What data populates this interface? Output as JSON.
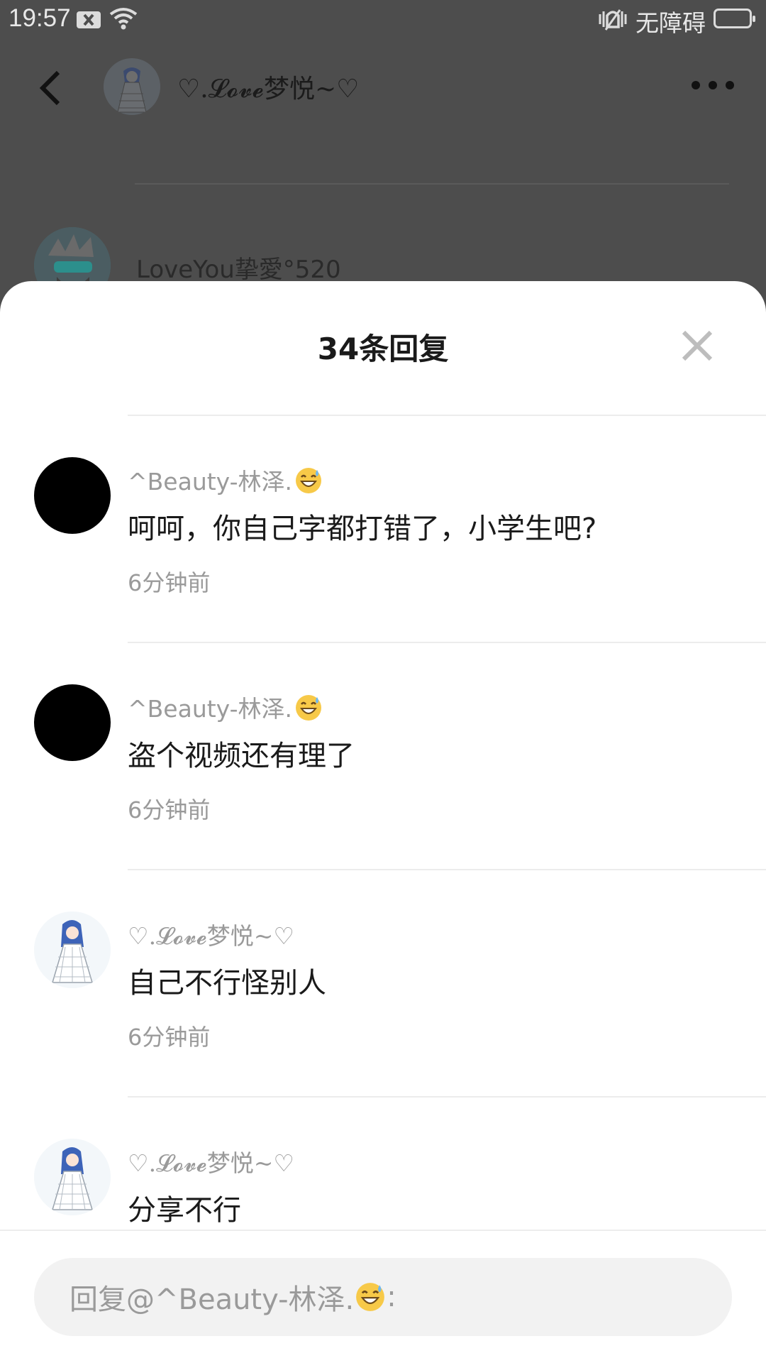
{
  "status_bar": {
    "time": "19:57",
    "accessibility_label": "无障碍"
  },
  "header": {
    "title": "♡.𝓛𝓸𝓿𝓮梦悦~♡",
    "background_comment_name": "LoveYou挚愛°520"
  },
  "sheet": {
    "title": "34条回复",
    "comments": [
      {
        "name": "^Beauty-林泽.",
        "name_emoji": "sweat-smile",
        "text": "呵呵，你自己字都打错了，小学生吧?",
        "time": "6分钟前",
        "avatar": "black"
      },
      {
        "name": "^Beauty-林泽.",
        "name_emoji": "sweat-smile",
        "text": "盗个视频还有理了",
        "time": "6分钟前",
        "avatar": "black"
      },
      {
        "name": "♡.𝓛𝓸𝓿𝓮梦悦~♡",
        "text": "自己不行怪别人",
        "time": "6分钟前",
        "avatar": "anime"
      },
      {
        "name": "♡.𝓛𝓸𝓿𝓮梦悦~♡",
        "text": "分享不行",
        "time": "",
        "avatar": "anime"
      }
    ]
  },
  "reply": {
    "prefix": "回复@^Beauty-林泽.",
    "suffix": ":",
    "emoji": "sweat-smile"
  },
  "colors": {
    "overlay_bg": "#4d4d4d",
    "sheet_bg": "#ffffff",
    "muted_text": "#9a9a9a",
    "primary_text": "#1a1a1a",
    "input_bg": "#f2f2f2"
  }
}
